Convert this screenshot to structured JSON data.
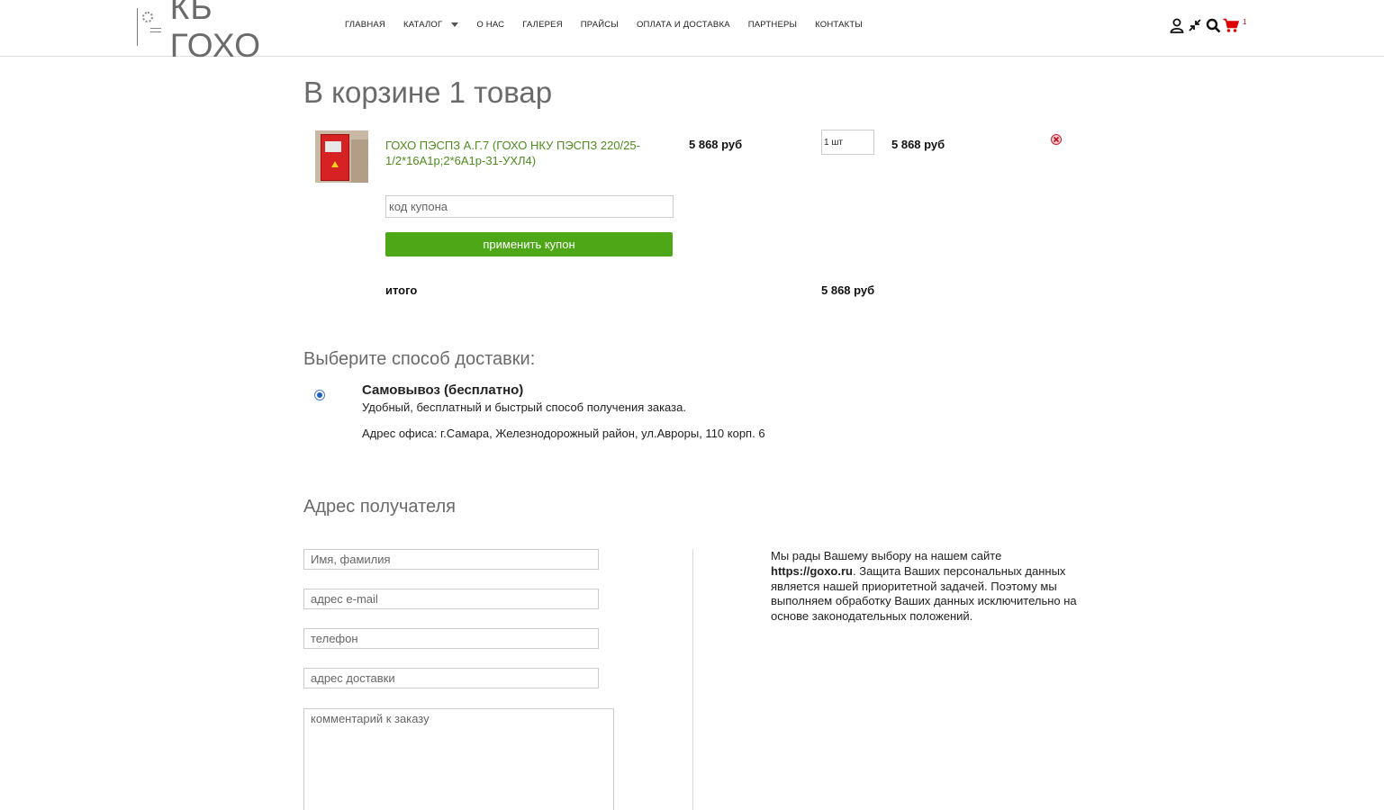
{
  "header": {
    "logo_text": "КБ ГОХО",
    "nav": [
      {
        "label": "ГЛАВНАЯ"
      },
      {
        "label": "КАТАЛОГ"
      },
      {
        "label": "О НАС"
      },
      {
        "label": "ГАЛЕРЕЯ"
      },
      {
        "label": "ПРАЙСЫ"
      },
      {
        "label": "ОПЛАТА И ДОСТАВКА"
      },
      {
        "label": "ПАРТНЕРЫ"
      },
      {
        "label": "КОНТАКТЫ"
      }
    ],
    "icons": [
      "user-icon",
      "compare-icon",
      "search-icon",
      "cart-icon"
    ],
    "cart_count": "1"
  },
  "cart": {
    "title": "В корзине 1 товар",
    "item": {
      "name": "ГОХО ПЭСПЗ А.Г.7 (ГОХО НКУ ПЭСПЗ 220/25-1/2*16А1р;2*6А1р-31-УХЛ4)",
      "unit_price": "5 868 руб",
      "quantity": "1 шт",
      "line_total": "5 868 руб"
    },
    "coupon_placeholder": "код купона",
    "coupon_button": "применить купон",
    "total_label": "итого",
    "total_value": "5 868 руб"
  },
  "delivery": {
    "title": "Выберите способ доставки:",
    "option_name": "Самовывоз (бесплатно)",
    "option_desc": "Удобный, бесплатный и быстрый способ получения заказа.",
    "option_address": "Адрес офиса: г.Самара, Железнодорожный район, ул.Авроры, 110 корп. 6",
    "selected": true
  },
  "recipient": {
    "title": "Адрес получателя",
    "name_placeholder": "Имя, фамилия",
    "email_placeholder": "адрес e-mail",
    "phone_placeholder": "телефон",
    "address_placeholder": "адрес доставки",
    "comment_placeholder": "комментарий к заказу"
  },
  "privacy": {
    "text_before": "Мы рады Вашему выбору на нашем сайте ",
    "site": "https://goxo.ru",
    "text_after": ". Защита Ваших персональных данных является нашей приоритетной задачей. Поэтому мы выполняем обработку Ваших данных исключительно на основе законодательных положений."
  },
  "colors": {
    "accent_green": "#4ea716",
    "link_green": "#4e8c1e",
    "cart_red": "#d00000",
    "heading_gray": "#6a6a6a"
  }
}
